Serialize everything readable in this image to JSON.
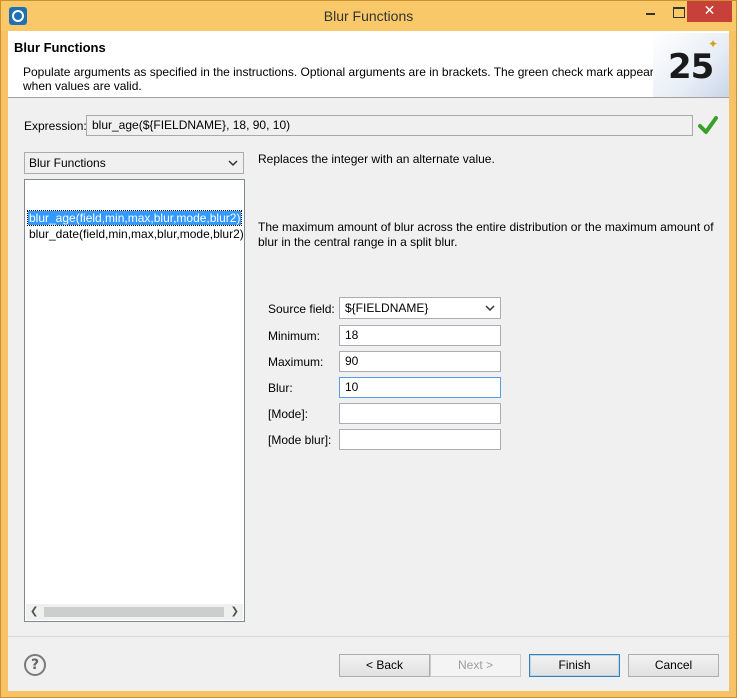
{
  "window": {
    "title": "Blur Functions",
    "close_glyph": "✕"
  },
  "header": {
    "title": "Blur Functions",
    "description": "Populate arguments as specified in the instructions. Optional arguments are in brackets. The green check mark appears when values are valid.",
    "banner_number": "25"
  },
  "expression": {
    "label": "Expression:",
    "value": "blur_age(${FIELDNAME}, 18, 90, 10)",
    "valid_icon": "check-icon",
    "valid_color": "#3aa02a"
  },
  "category": {
    "selected": "Blur Functions"
  },
  "functions": [
    {
      "label": "blur_age(field,min,max,blur,mode,blur2)",
      "selected": true
    },
    {
      "label": "blur_date(field,min,max,blur,mode,blur2)",
      "selected": false
    }
  ],
  "details": {
    "summary": "Replaces the integer with an alternate value.",
    "argument_help": "The maximum amount of blur across the entire distribution or the maximum amount of blur in the central range in a split blur."
  },
  "form": {
    "source_field": {
      "label": "Source field:",
      "value": "${FIELDNAME}"
    },
    "minimum": {
      "label": "Minimum:",
      "value": "18"
    },
    "maximum": {
      "label": "Maximum:",
      "value": "90"
    },
    "blur": {
      "label": "Blur:",
      "value": "10"
    },
    "mode": {
      "label": "[Mode]:",
      "value": ""
    },
    "mode_blur": {
      "label": "[Mode blur]:",
      "value": ""
    }
  },
  "buttons": {
    "help": "?",
    "back": "< Back",
    "next": "Next >",
    "finish": "Finish",
    "cancel": "Cancel"
  },
  "colors": {
    "selection": "#3399ff",
    "title_bar": "#f9c969",
    "close_button": "#c7403a"
  }
}
